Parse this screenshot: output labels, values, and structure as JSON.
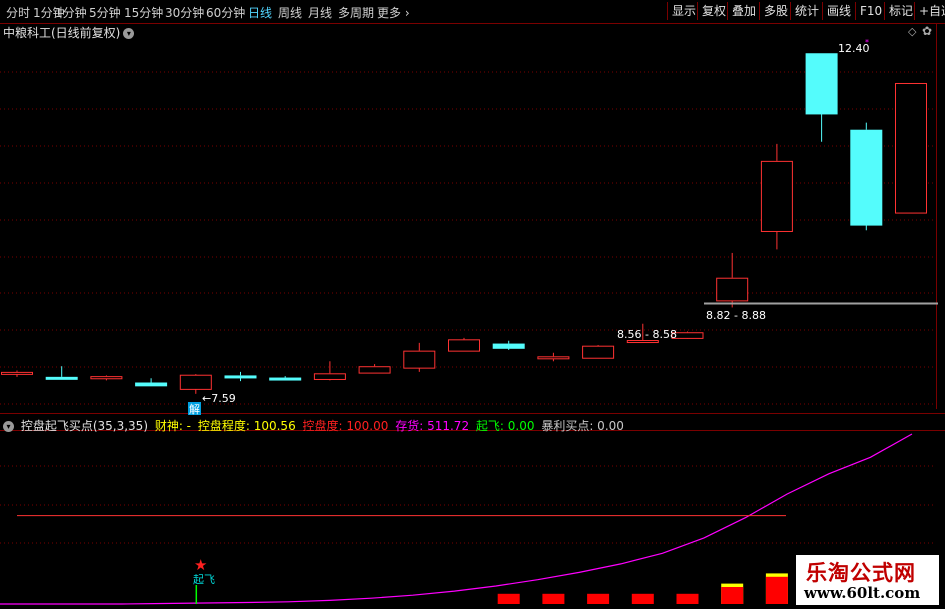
{
  "toolbar": {
    "periods": [
      "分时",
      "1分钟",
      "5分钟",
      "15分钟",
      "30分钟",
      "60分钟",
      "日线",
      "周线",
      "月线",
      "多周期",
      "更多"
    ],
    "active_period": "日线",
    "right_buttons": [
      "显示",
      "复权",
      "叠加",
      "多股",
      "统计",
      "画线",
      "F10",
      "标记",
      "+自选"
    ]
  },
  "header": {
    "stock_title": "中粮科工(日线前复权)"
  },
  "annotations": {
    "low_label": "←7.59",
    "jie_badge": "解",
    "range1": "8.56 - 8.58",
    "range2": "8.82 - 8.88",
    "high_label": "12.40",
    "qifei_label": "起飞"
  },
  "indicator": {
    "name": "控盘起飞买点(35,3,35)",
    "caishen_label": "财神: -",
    "kongpan_label": "控盘程度: 100.56",
    "kongpandu_label": "控盘度: 100.00",
    "cunhuo_label": "存货: 511.72",
    "qifei_label": "起飞: 0.00",
    "baoli_label": "暴利买点: 0.00"
  },
  "watermark": {
    "line1": "乐淘公式网",
    "line2": "www.60lt.com"
  },
  "colors": {
    "up": "#ff3232",
    "down": "#54fcfc",
    "line": "#ff00ff",
    "grid": "#7a0000"
  },
  "chart_data": {
    "type": "candlestick",
    "ohlc": [
      {
        "o": 7.88,
        "h": 7.92,
        "l": 7.83,
        "c": 7.9
      },
      {
        "o": 7.83,
        "h": 7.98,
        "l": 7.8,
        "c": 7.82
      },
      {
        "o": 7.81,
        "h": 7.85,
        "l": 7.78,
        "c": 7.84
      },
      {
        "o": 7.75,
        "h": 7.81,
        "l": 7.7,
        "c": 7.71
      },
      {
        "o": 7.66,
        "h": 7.87,
        "l": 7.59,
        "c": 7.86
      },
      {
        "o": 7.85,
        "h": 7.9,
        "l": 7.77,
        "c": 7.83
      },
      {
        "o": 7.82,
        "h": 7.84,
        "l": 7.79,
        "c": 7.8
      },
      {
        "o": 7.8,
        "h": 8.05,
        "l": 7.78,
        "c": 7.88
      },
      {
        "o": 7.89,
        "h": 8.01,
        "l": 7.88,
        "c": 7.98
      },
      {
        "o": 7.96,
        "h": 8.31,
        "l": 7.9,
        "c": 8.2
      },
      {
        "o": 8.2,
        "h": 8.38,
        "l": 8.19,
        "c": 8.36
      },
      {
        "o": 8.3,
        "h": 8.34,
        "l": 8.21,
        "c": 8.24
      },
      {
        "o": 8.1,
        "h": 8.17,
        "l": 8.05,
        "c": 8.12
      },
      {
        "o": 8.1,
        "h": 8.28,
        "l": 8.09,
        "c": 8.27
      },
      {
        "o": 8.34,
        "h": 8.58,
        "l": 8.31,
        "c": 8.35
      },
      {
        "o": 8.38,
        "h": 8.47,
        "l": 8.37,
        "c": 8.46
      },
      {
        "o": 8.91,
        "h": 9.58,
        "l": 8.81,
        "c": 9.23
      },
      {
        "o": 9.89,
        "h": 11.12,
        "l": 9.63,
        "c": 10.88
      },
      {
        "o": 12.4,
        "h": 12.4,
        "l": 11.15,
        "c": 11.55
      },
      {
        "o": 11.32,
        "h": 11.42,
        "l": 9.9,
        "c": 9.98
      },
      {
        "o": 10.15,
        "h": 11.98,
        "l": 10.15,
        "c": 11.98
      }
    ],
    "price_range": [
      7.39,
      12.7
    ],
    "sub_range": [
      0,
      100
    ],
    "line_values": [
      0,
      0,
      0,
      0,
      0.3,
      0.6,
      0.9,
      1.3,
      2.1,
      3.4,
      5.2,
      7.6,
      10.6,
      14.3,
      18.6,
      23.6,
      29.8,
      38.9,
      50.8,
      64.7,
      76.6,
      86.3,
      100
    ],
    "bar_values": [
      0,
      0,
      0,
      0,
      0,
      0,
      0,
      0,
      0,
      0,
      0,
      6,
      6,
      6,
      6,
      6,
      10,
      16,
      18,
      20,
      26
    ],
    "ceiling_values": [
      0,
      0,
      0,
      0,
      0,
      0,
      0,
      0,
      0,
      0,
      0,
      0,
      0,
      0,
      0,
      2,
      12,
      18,
      22,
      24,
      28
    ],
    "signal_index": 4,
    "guide_level": 52
  }
}
